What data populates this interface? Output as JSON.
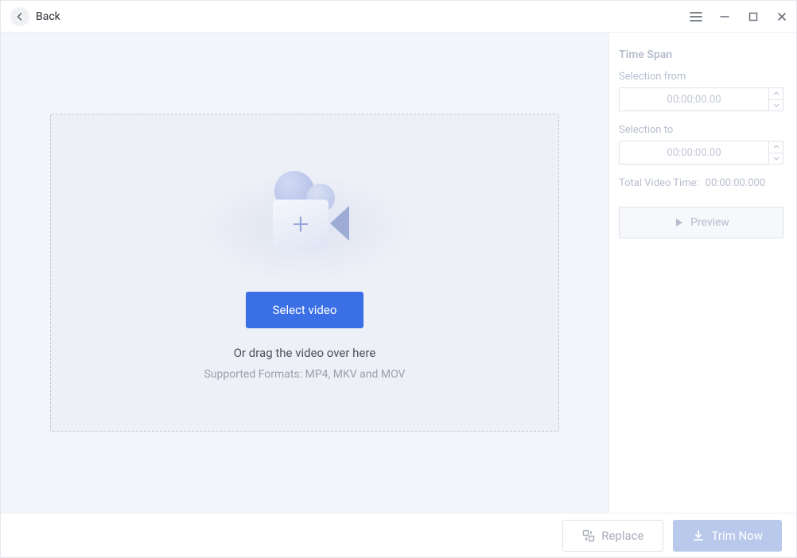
{
  "titlebar": {
    "back_label": "Back"
  },
  "dropzone": {
    "select_button": "Select video",
    "drag_text": "Or drag the video over here",
    "formats_text": "Supported Formats: MP4, MKV and MOV"
  },
  "sidebar": {
    "title": "Time Span",
    "from_label": "Selection from",
    "from_value": "00:00:00.00",
    "to_label": "Selection to",
    "to_value": "00:00:00.00",
    "total_label": "Total Video Time:",
    "total_value": "00:00:00.000",
    "preview_label": "Preview"
  },
  "footer": {
    "replace_label": "Replace",
    "trim_label": "Trim Now"
  }
}
